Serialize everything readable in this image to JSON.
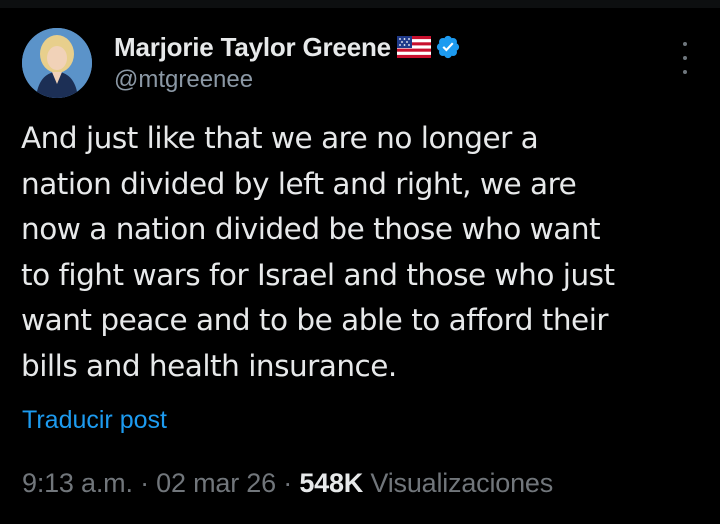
{
  "author": {
    "display_name": "Marjorie Taylor Greene",
    "handle": "@mtgreenee",
    "avatar_icon": "profile-photo",
    "flag_icon": "us-flag-icon",
    "verified_icon": "verified-badge-icon",
    "verified_color": "#1d9bf0"
  },
  "menu": {
    "icon": "vertical-ellipsis-icon"
  },
  "tweet": {
    "text": "And just like that we are no longer a\nnation divided by left and right, we are\nnow a nation divided be those who want\nto fight wars for Israel and those who just\nwant peace and to be able to afford their\nbills and health insurance.",
    "translate_label": "Traducir post"
  },
  "meta": {
    "time": "9:13 a.m.",
    "separator": " · ",
    "date": "02 mar 26",
    "views_count": "548K",
    "views_label": " Visualizaciones"
  },
  "colors": {
    "background": "#000000",
    "text": "#e7e9ea",
    "secondary_text": "#71767b",
    "link": "#1d9bf0"
  }
}
